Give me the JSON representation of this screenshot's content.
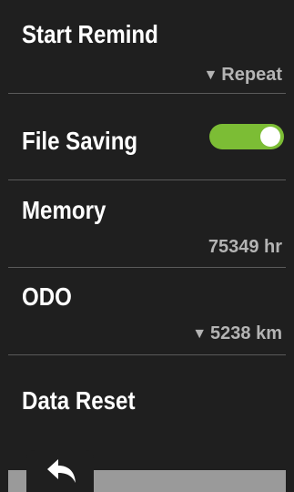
{
  "settings": {
    "start_remind": {
      "label": "Start Remind",
      "value": "Repeat"
    },
    "file_saving": {
      "label": "File Saving",
      "enabled": true
    },
    "memory": {
      "label": "Memory",
      "value": "75349 hr"
    },
    "odo": {
      "label": "ODO",
      "value": "5238 km"
    },
    "data_reset": {
      "label": "Data Reset"
    }
  },
  "icons": {
    "dropdown": "triangle-down-icon",
    "back": "back-arrow-icon"
  },
  "colors": {
    "background": "#1f1f1f",
    "text": "#ffffff",
    "value_text": "#b4b4b4",
    "toggle_on": "#7cbd35",
    "divider": "#5a5a5a"
  }
}
